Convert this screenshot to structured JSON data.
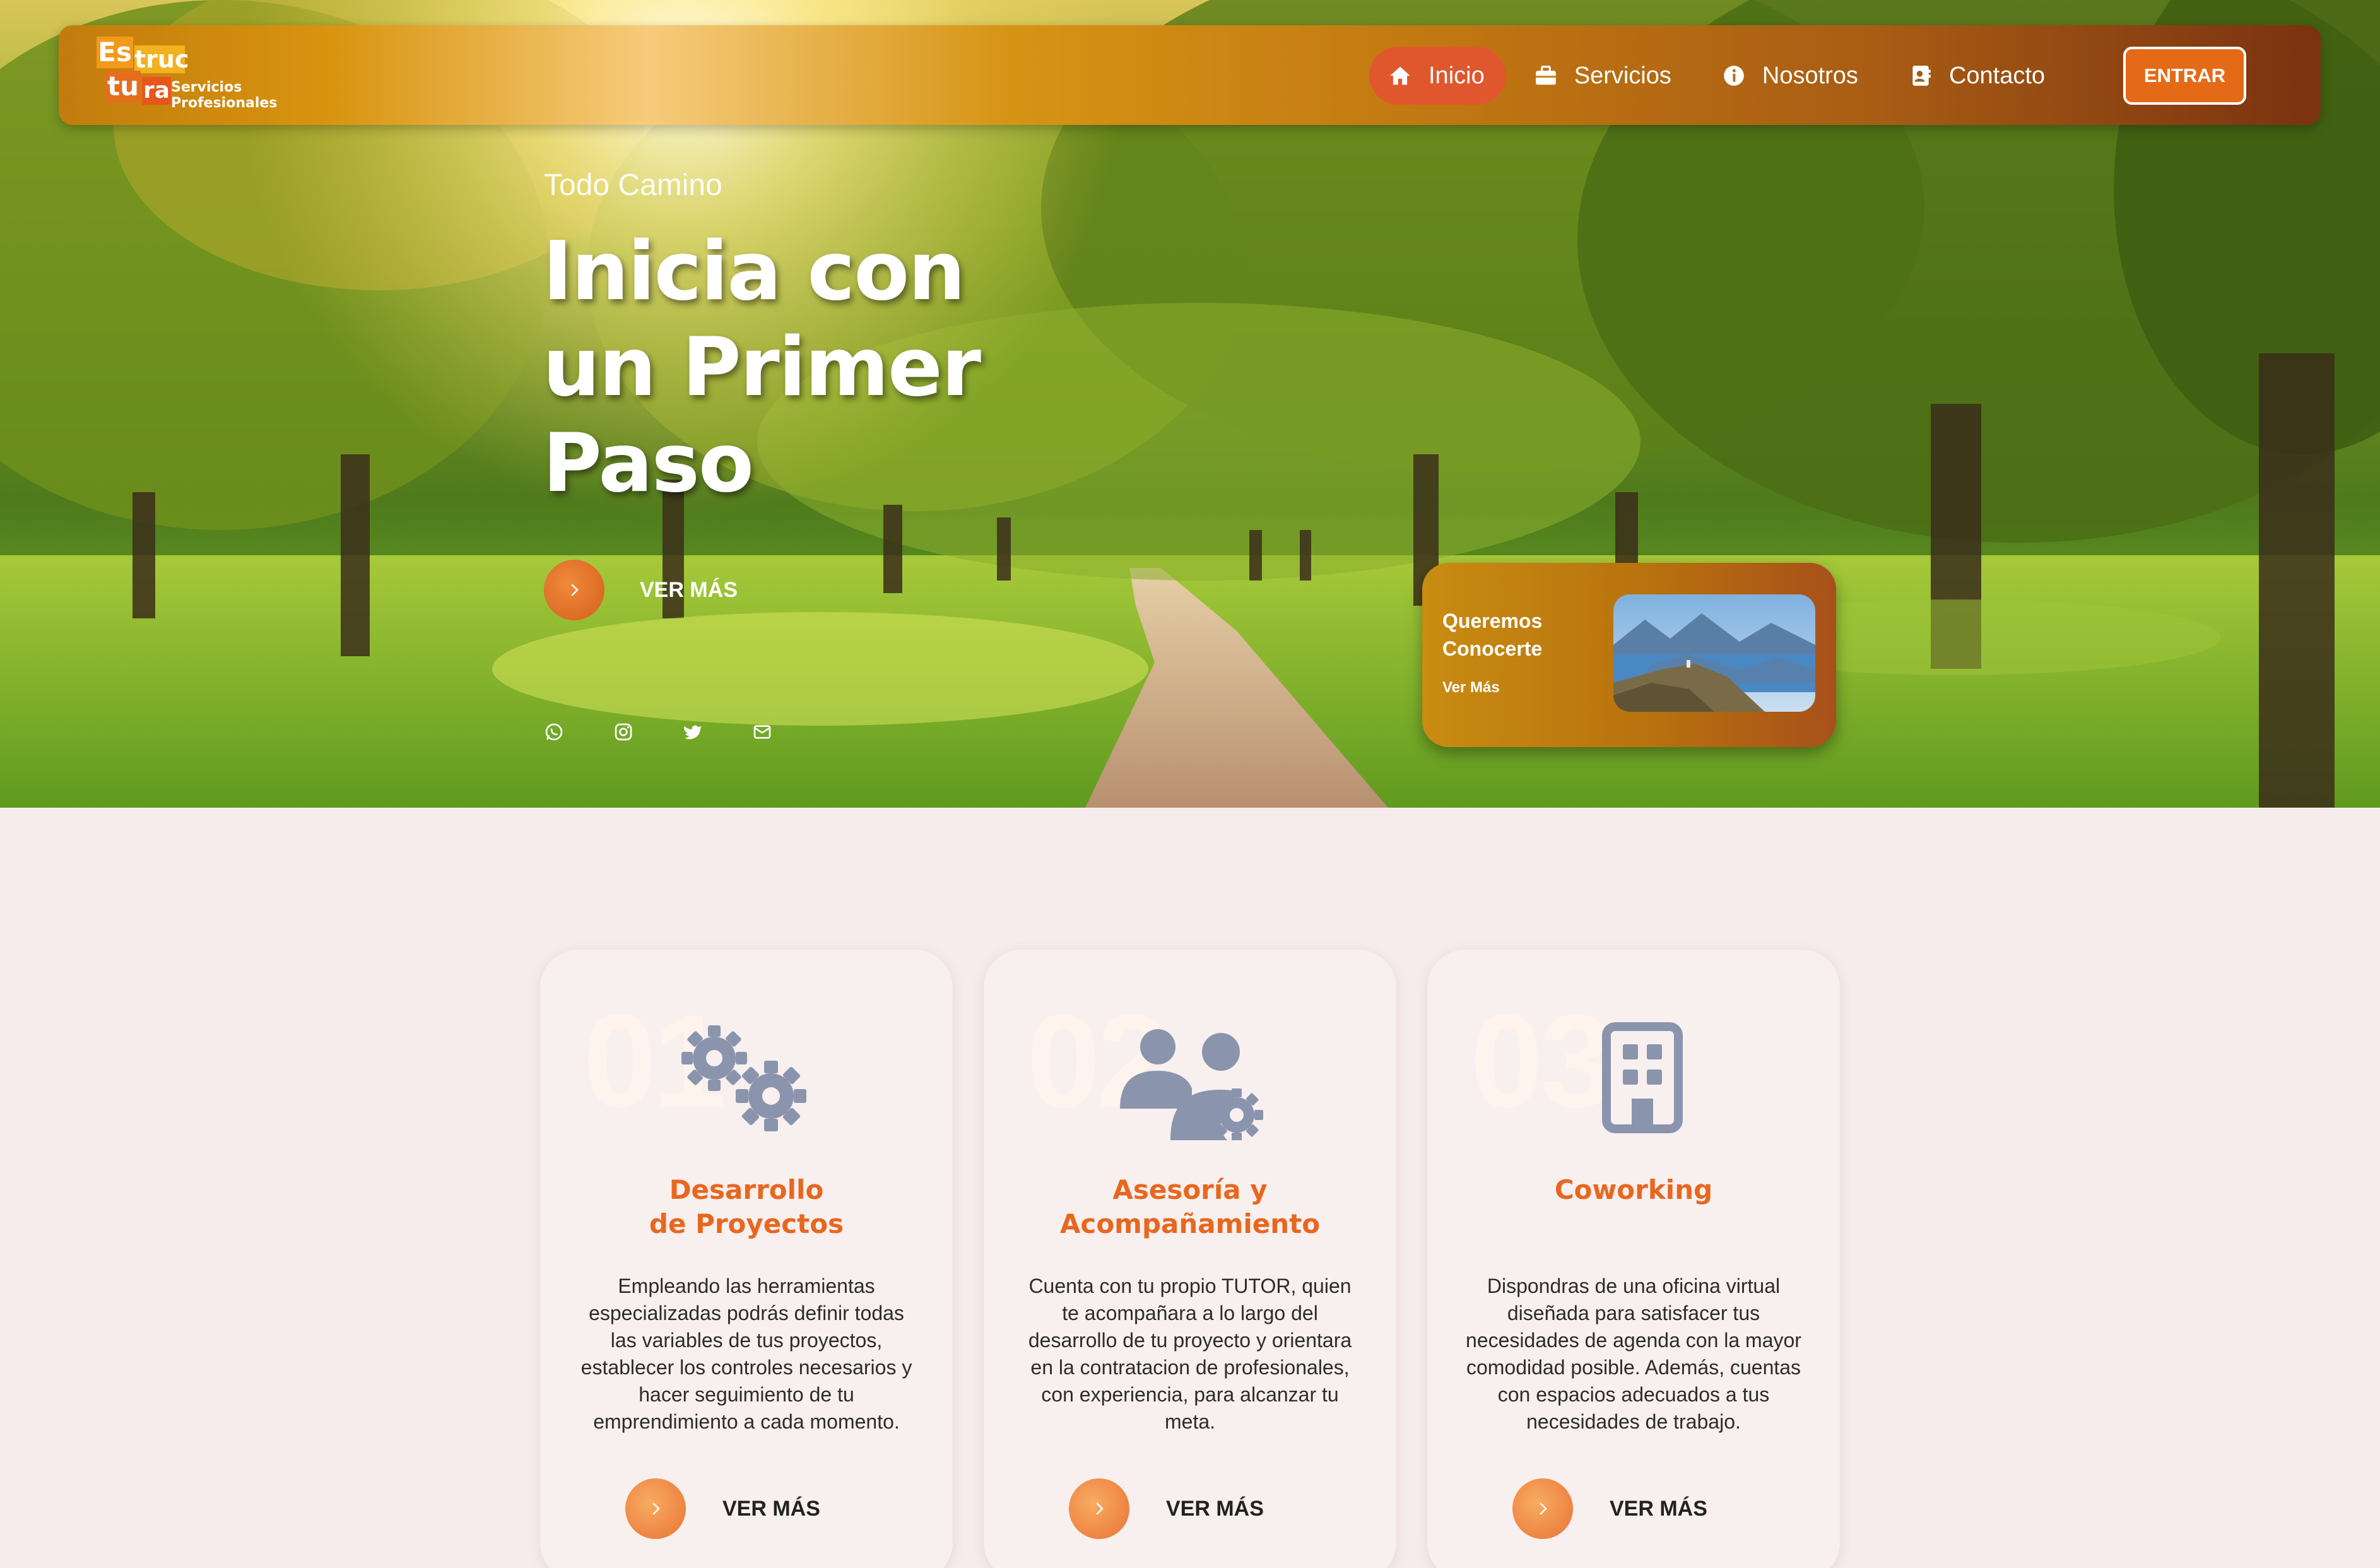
{
  "brand": {
    "logo_blocks": [
      "Es",
      "truc",
      "tu",
      "ra"
    ],
    "logo_sub": "Servicios",
    "logo_sub2": "Profesionales"
  },
  "nav": {
    "items": [
      {
        "label": "Inicio",
        "icon": "home-icon"
      },
      {
        "label": "Servicios",
        "icon": "briefcase-icon"
      },
      {
        "label": "Nosotros",
        "icon": "info-icon"
      },
      {
        "label": "Contacto",
        "icon": "contact-card-icon"
      }
    ],
    "login_label": "ENTRAR"
  },
  "hero": {
    "eyebrow": "Todo Camino",
    "headline_lines": [
      "Inicia con",
      "un Primer",
      "Paso"
    ],
    "cta_label": "VER MÁS",
    "socials": [
      "whatsapp-icon",
      "instagram-icon",
      "twitter-icon",
      "mail-icon"
    ]
  },
  "promo": {
    "title_line1": "Queremos",
    "title_line2": "Conocerte",
    "link": "Ver Más"
  },
  "services": [
    {
      "number": "01",
      "icon": "gears-icon",
      "title_line1": "Desarrollo",
      "title_line2": "de Proyectos",
      "description": "Empleando las herramientas especializadas podrás definir todas las variables de tus proyectos, establecer los controles necesarios y hacer seguimiento de tu emprendimiento a cada momento.",
      "cta": "VER MÁS"
    },
    {
      "number": "02",
      "icon": "users-gear-icon",
      "title_line1": "Asesoría y",
      "title_line2": "Acompañamiento",
      "description": "Cuenta con tu propio TUTOR, quien te acompañara a lo largo del desarrollo de tu proyecto y orientara en la contratacion de profesionales, con experiencia, para alcanzar tu meta.",
      "cta": "VER MÁS"
    },
    {
      "number": "03",
      "icon": "building-icon",
      "title_line1": "Coworking",
      "title_line2": "",
      "description": "Dispondras de una oficina virtual diseñada para satisfacer tus necesidades de agenda con la mayor comodidad posible. Además, cuentas con espacios adecuados a tus necesidades de trabajo.",
      "cta": "VER MÁS"
    }
  ],
  "colors": {
    "accent": "#e7671f",
    "nav_active": "#e0572e",
    "page_bg": "#f6ecec",
    "icon_gray": "#8b94ad"
  }
}
